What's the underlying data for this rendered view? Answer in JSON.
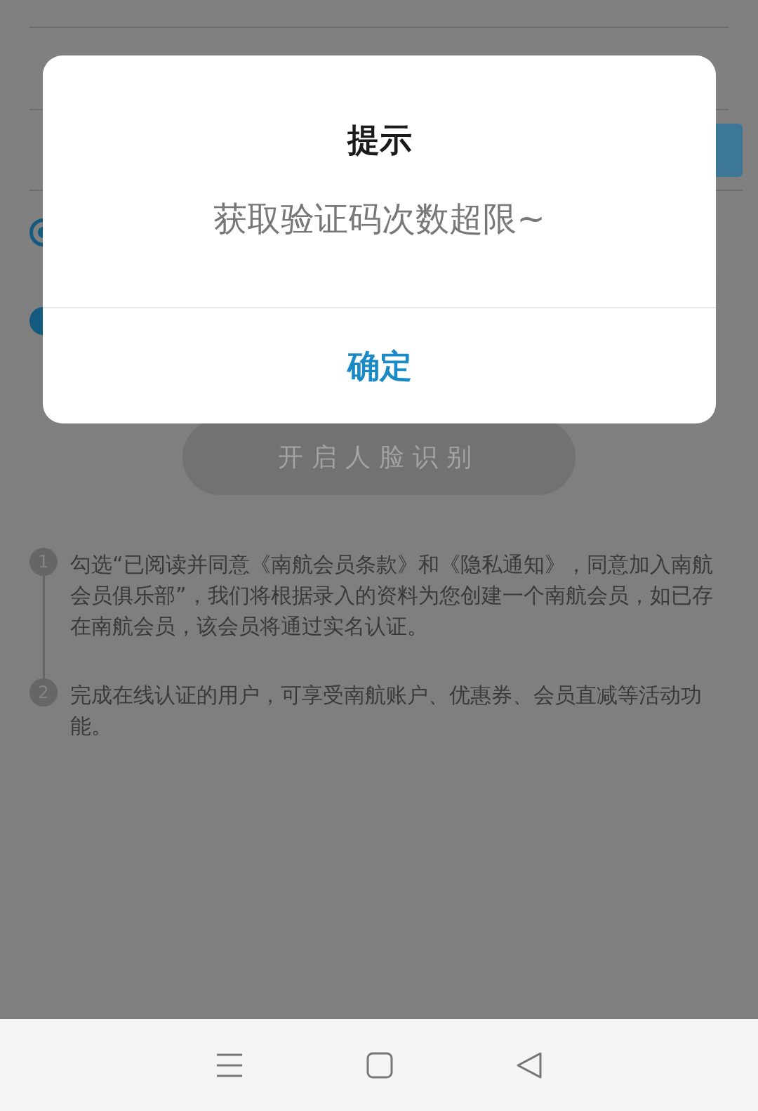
{
  "form": {
    "options": [
      {
        "kind": "radio",
        "checked": true
      },
      {
        "kind": "checkbox",
        "checked": true
      }
    ]
  },
  "face_button": {
    "label": "开启人脸识别",
    "disabled": true
  },
  "notes": [
    {
      "number": "1",
      "text": "勾选“已阅读并同意《南航会员条款》和《隐私通知》，同意加入南航会员俱乐部”，我们将根据录入的资料为您创建一个南航会员，如已存在南航会员，该会员将通过实名认证。"
    },
    {
      "number": "2",
      "text": "完成在线认证的用户，可享受南航账户、优惠券、会员直减等活动功能。"
    }
  ],
  "dialog": {
    "title": "提示",
    "message": "获取验证码次数超限~",
    "button": "确定"
  }
}
